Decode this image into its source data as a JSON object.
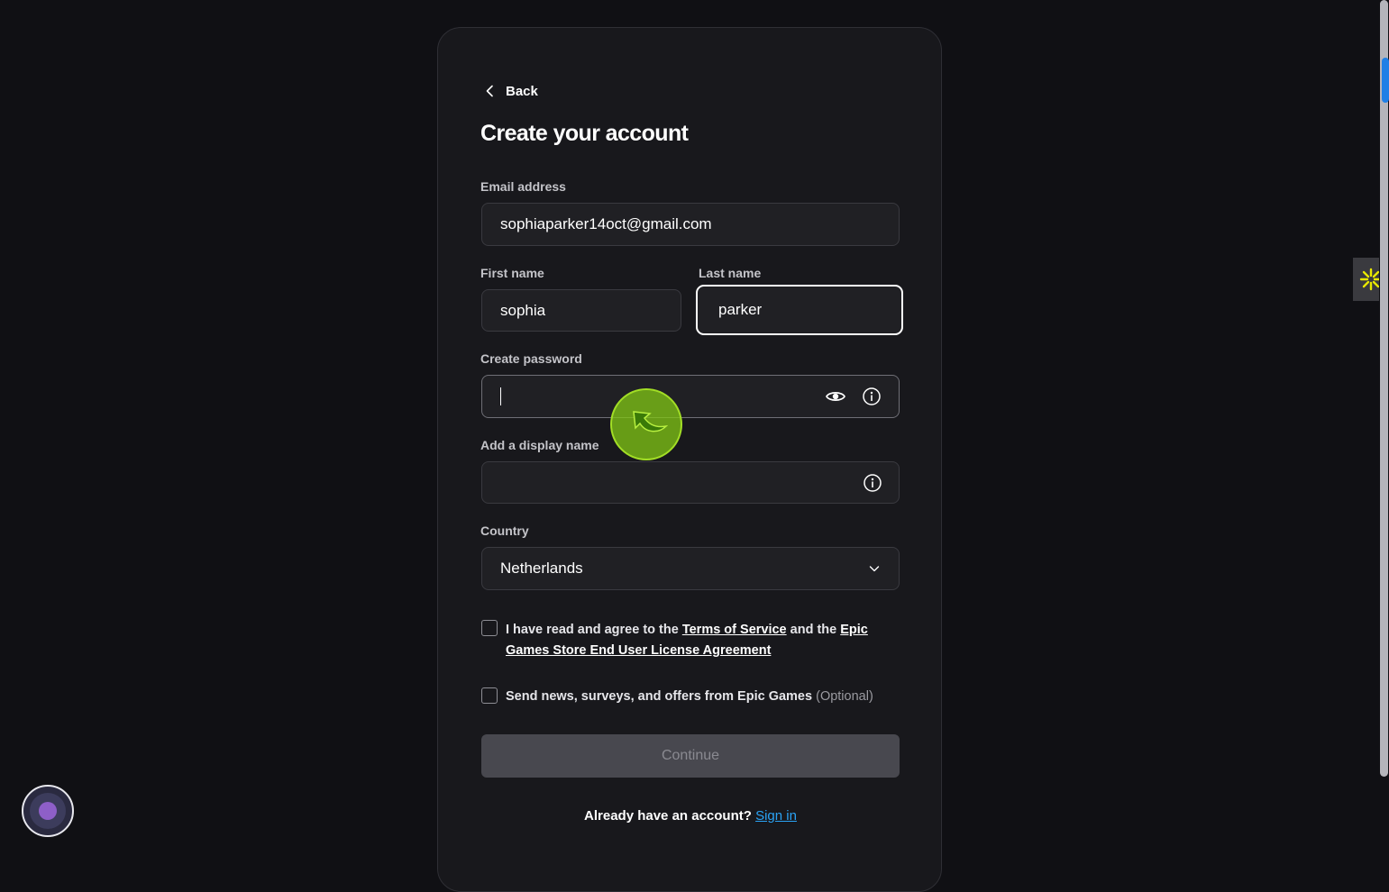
{
  "nav": {
    "back_label": "Back"
  },
  "form": {
    "title": "Create your account",
    "email": {
      "label": "Email address",
      "value": "sophiaparker14oct@gmail.com"
    },
    "first_name": {
      "label": "First name",
      "value": "sophia"
    },
    "last_name": {
      "label": "Last name",
      "value": "parker"
    },
    "password": {
      "label": "Create password",
      "value": ""
    },
    "display_name": {
      "label": "Add a display name",
      "value": ""
    },
    "country": {
      "label": "Country",
      "value": "Netherlands"
    },
    "terms": {
      "text_before": "I have read and agree to the ",
      "tos_link": "Terms of Service",
      "text_middle": " and the ",
      "eula_link": "Epic Games Store End User License Agreement",
      "checked": false
    },
    "news": {
      "text": "Send news, surveys, and offers from Epic Games",
      "optional": "(Optional)",
      "checked": false
    },
    "continue_label": "Continue",
    "signin": {
      "prompt": "Already have an account?",
      "link": "Sign in"
    }
  },
  "colors": {
    "background": "#101014",
    "card": "#18181c",
    "link": "#2aa3f5",
    "button_disabled": "#48484f",
    "extension_accent": "#e8e800",
    "scroll_accent": "#1f7fe6"
  },
  "icons": {
    "back": "chevron-left-icon",
    "password_visibility": "eye-icon",
    "password_info": "info-icon",
    "display_name_info": "info-icon",
    "country_dropdown": "chevron-down-icon",
    "extension": "asterisk-burst-icon",
    "assistant": "assistant-orb-icon"
  }
}
